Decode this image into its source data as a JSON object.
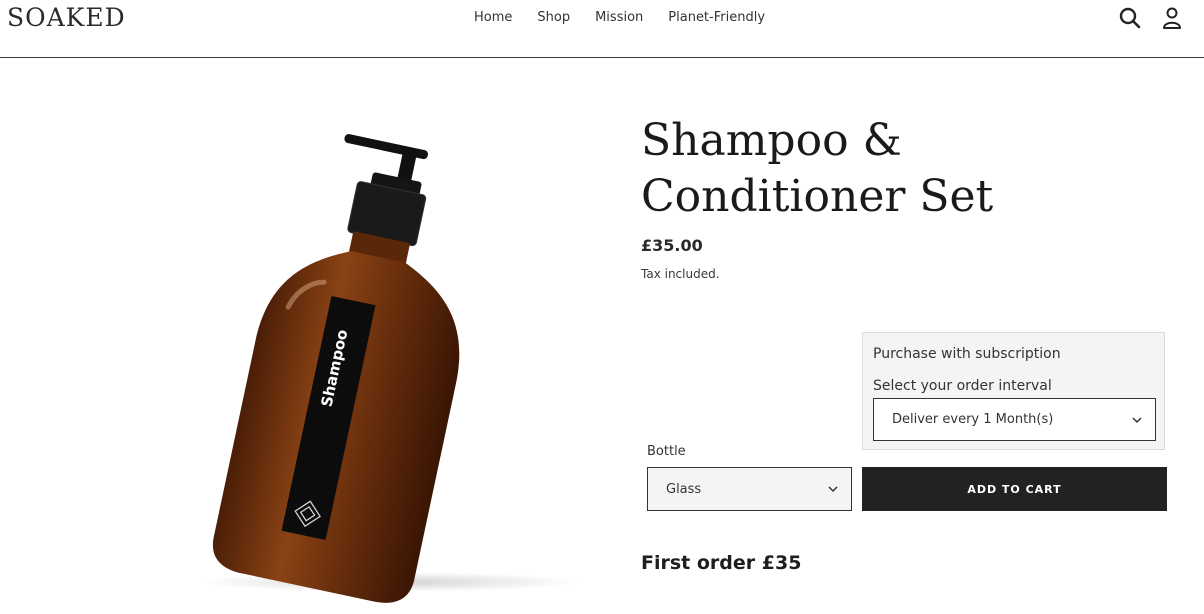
{
  "header": {
    "logo": "SOAKED",
    "nav": [
      "Home",
      "Shop",
      "Mission",
      "Planet-Friendly"
    ],
    "icons": [
      "search-icon",
      "account-icon"
    ]
  },
  "product": {
    "title": "Shampoo & Conditioner Set",
    "price": "£35.00",
    "tax_note": "Tax included.",
    "image_label": "Shampoo"
  },
  "subscription": {
    "title": "Purchase with subscription",
    "interval_label": "Select your order interval",
    "interval_value": "Deliver every 1 Month(s)"
  },
  "bottle": {
    "label": "Bottle",
    "value": "Glass"
  },
  "cart": {
    "button": "ADD TO CART"
  },
  "promo": {
    "first_order": "First order £35"
  }
}
